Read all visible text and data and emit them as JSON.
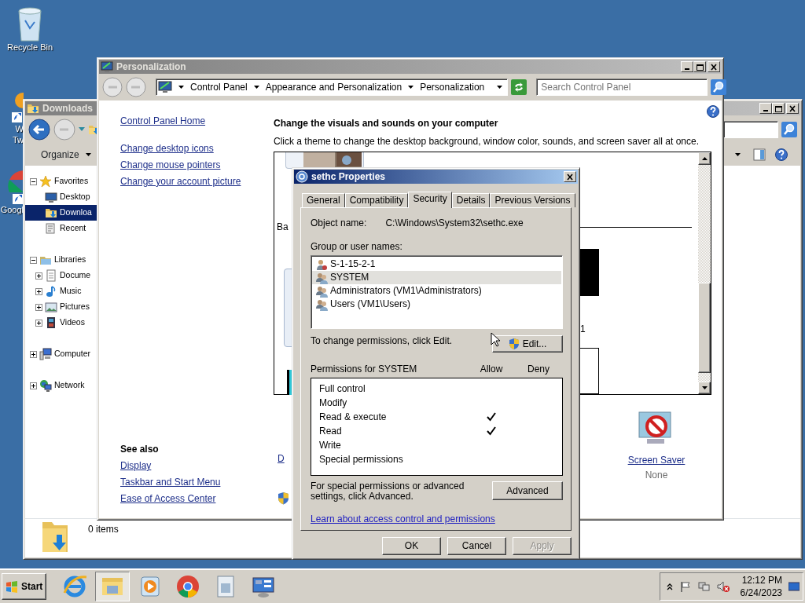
{
  "desktop": {
    "icons": [
      {
        "kind": "recycle",
        "label_lines": [
          "Recycle Bin"
        ]
      },
      {
        "kind": "shortcut",
        "label_lines": [
          "W",
          "Tw"
        ]
      },
      {
        "kind": "chrome",
        "label_lines": [
          "Googl"
        ]
      }
    ]
  },
  "downloads_window": {
    "title": "Downloads",
    "organize": "Organize",
    "nav_tree": [
      {
        "label": "Favorites",
        "kind": "favorites",
        "expanded": true,
        "selected": false,
        "children": [
          {
            "label": "Desktop",
            "kind": "desktop",
            "selected": false
          },
          {
            "label": "Downloa",
            "kind": "downloads",
            "selected": true
          },
          {
            "label": "Recent",
            "kind": "recent",
            "selected": false
          }
        ]
      },
      {
        "label": "Libraries",
        "kind": "libraries",
        "expanded": true,
        "selected": false,
        "children": [
          {
            "label": "Docume",
            "kind": "documents",
            "expanded": false,
            "selected": false
          },
          {
            "label": "Music",
            "kind": "music",
            "expanded": false,
            "selected": false
          },
          {
            "label": "Pictures",
            "kind": "pictures",
            "expanded": false,
            "selected": false
          },
          {
            "label": "Videos",
            "kind": "videos",
            "expanded": false,
            "selected": false
          }
        ]
      },
      {
        "label": "Computer",
        "kind": "computer",
        "expanded": false,
        "selected": false
      },
      {
        "label": "Network",
        "kind": "network",
        "expanded": false,
        "selected": false
      }
    ],
    "status": "0 items"
  },
  "personalization_window": {
    "title": "Personalization",
    "breadcrumb": [
      "Control Panel",
      "Appearance and Personalization",
      "Personalization"
    ],
    "search": {
      "placeholder": "Search Control Panel"
    },
    "tasks": [
      "Control Panel Home",
      "Change desktop icons",
      "Change mouse pointers",
      "Change your account picture"
    ],
    "see_also": {
      "heading": "See also",
      "links": [
        "Display",
        "Taskbar and Start Menu",
        "Ease of Access Center"
      ]
    },
    "heading": "Change the visuals and sounds on your computer",
    "description": "Click a theme to change the desktop background, window color, sounds, and screen saver all at once.",
    "theme_fragments": [
      "Ba",
      "1"
    ],
    "bottom_fragment": "D",
    "screen_saver": {
      "label": "Screen Saver",
      "value": "None"
    }
  },
  "properties_dialog": {
    "title": "sethc Properties",
    "tabs": [
      {
        "label": "General",
        "selected": false
      },
      {
        "label": "Compatibility",
        "selected": false
      },
      {
        "label": "Security",
        "selected": true
      },
      {
        "label": "Details",
        "selected": false
      },
      {
        "label": "Previous Versions",
        "selected": false
      }
    ],
    "object_label": "Object name:",
    "object_name": "C:\\Windows\\System32\\sethc.exe",
    "group_label": "Group or user names:",
    "principals": [
      {
        "name": "S-1-15-2-1",
        "kind": "user",
        "selected": false
      },
      {
        "name": "SYSTEM",
        "kind": "group",
        "selected": true
      },
      {
        "name": "Administrators (VM1\\Administrators)",
        "kind": "group",
        "selected": false
      },
      {
        "name": "Users (VM1\\Users)",
        "kind": "group",
        "selected": false
      }
    ],
    "edit_hint": "To change permissions, click Edit.",
    "edit_button": "Edit...",
    "permissions_label": "Permissions for SYSTEM",
    "columns": [
      "Allow",
      "Deny"
    ],
    "permissions": [
      {
        "name": "Full control",
        "allow": false,
        "deny": false
      },
      {
        "name": "Modify",
        "allow": false,
        "deny": false
      },
      {
        "name": "Read & execute",
        "allow": true,
        "deny": false
      },
      {
        "name": "Read",
        "allow": true,
        "deny": false
      },
      {
        "name": "Write",
        "allow": false,
        "deny": false
      },
      {
        "name": "Special permissions",
        "allow": false,
        "deny": false
      }
    ],
    "advanced_hint": "For special permissions or advanced settings, click Advanced.",
    "advanced_button": "Advanced",
    "link": "Learn about access control and permissions",
    "buttons": [
      {
        "label": "OK",
        "disabled": false
      },
      {
        "label": "Cancel",
        "disabled": false
      },
      {
        "label": "Apply",
        "disabled": true
      }
    ]
  },
  "taskbar": {
    "start": "Start",
    "apps": [
      {
        "kind": "ie",
        "active": false
      },
      {
        "kind": "explorer",
        "active": true
      },
      {
        "kind": "media",
        "active": false
      },
      {
        "kind": "chrome",
        "active": false
      },
      {
        "kind": "document",
        "active": false
      },
      {
        "kind": "control",
        "active": false
      }
    ],
    "time": "12:12 PM",
    "date": "6/24/2023"
  }
}
